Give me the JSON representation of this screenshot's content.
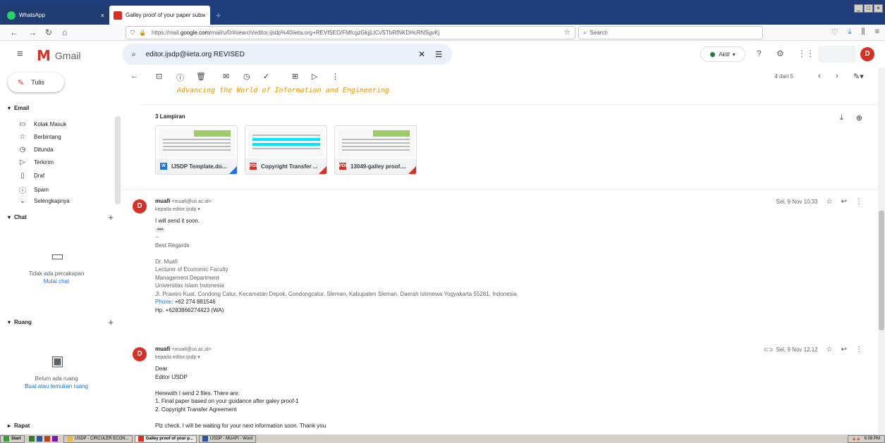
{
  "browser": {
    "tabs": [
      {
        "label": "WhatsApp",
        "close": "×"
      },
      {
        "label": "Galley proof of your paper submi",
        "close": "×"
      }
    ],
    "new_tab": "+",
    "url_prefix": "https://mail.",
    "url_domain": "google.com",
    "url_rest": "/mail/u/0/#search/editor.ijsdp%40iieta.org+REVISED/FMfcgzGkjjLtCvSTbRfNKDHcRNSgvKj",
    "search_placeholder": "Search",
    "window_controls": [
      "_",
      "□",
      "×"
    ]
  },
  "gmail": {
    "app_name": "Gmail",
    "search_query": "editor.ijsdp@iieta.org REVISED",
    "status": "Aktif",
    "avatar_letter": "D"
  },
  "sidebar": {
    "compose": "Tulis",
    "email_section": "Email",
    "items": [
      {
        "label": "Kotak Masuk",
        "icon": "inbox-icon"
      },
      {
        "label": "Berbintang",
        "icon": "star-icon"
      },
      {
        "label": "Ditunda",
        "icon": "clock-icon"
      },
      {
        "label": "Terkirim",
        "icon": "send-icon"
      },
      {
        "label": "Draf",
        "icon": "draft-icon"
      },
      {
        "label": "Spam",
        "icon": "spam-icon"
      },
      {
        "label": "Selengkapnya",
        "icon": "chevron-down-icon"
      }
    ],
    "chat_section": "Chat",
    "chat_empty": "Tidak ada percakapan",
    "chat_link": "Mulai chat",
    "space_section": "Ruang",
    "space_empty": "Belum ada ruang",
    "space_link": "Buat atau temukan ruang",
    "meet_section": "Rapat"
  },
  "toolbar": {
    "pager": "4 dari 5"
  },
  "thread": {
    "banner": "Advancing the World of Information and Engineering",
    "attachments_title": "3 Lampiran",
    "attachments": [
      {
        "name": "IJSDP Template.do...",
        "type": "W",
        "color": "#1a73e8"
      },
      {
        "name": "Copyright Transfer ...",
        "type": "PDF",
        "color": "#d93025"
      },
      {
        "name": "13049-galley proof....",
        "type": "PDF",
        "color": "#d93025"
      }
    ],
    "messages": [
      {
        "avatar": "D",
        "sender": "muafi",
        "email": "<muafi@uii.ac.id>",
        "to": "kepada editor.ijsdp ▾",
        "date": "Sel, 9 Nov 10.33",
        "lines": [
          "I will send it soon."
        ],
        "dots": "•••",
        "sig": [
          "--",
          "Best Regards",
          "",
          "Dr. Muafi",
          "Lecturer of Economic Faculty",
          "Management Department",
          "Universitas Islam Indonesia",
          "Jl. Prawiro Kuat, Condong Catur, Kecamatan Depok, Condongcatur, Sleman, Kabupaten Sleman, Daerah Istimewa Yogyakarta 55281, Indonesia"
        ],
        "phone_label": "Phone",
        "phone": ": +62 274 881546",
        "hp": "Hp. +6283866274423 (WA)"
      },
      {
        "avatar": "D",
        "sender": "muafi",
        "email": "<muafi@uii.ac.id>",
        "to": "kepada editor.ijsdp ▾",
        "date": "Sel, 9 Nov 12.12",
        "lines": [
          "Dear",
          "Editor IJSDP",
          "",
          "Herewith I send 2 files. There are:",
          "1. Final paper based on your guidance after galey proof-1",
          "2. Copyright Transfer Agreement",
          "",
          "Plz check. I will be waiting for your next information soon. Thank you"
        ]
      }
    ]
  },
  "taskbar": {
    "start": "Start",
    "items": [
      "IJSDP - CIRCULER ECON...",
      "Galley proof of your p...",
      "IJSDP - MUAFI - Word"
    ],
    "clock": "6:08 PM"
  }
}
